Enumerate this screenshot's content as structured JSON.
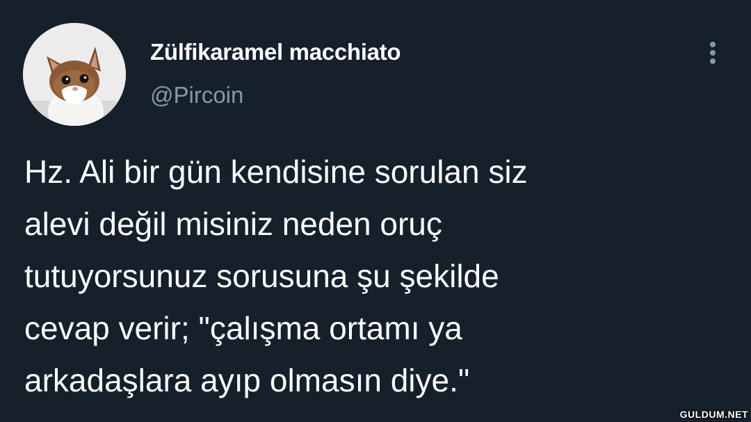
{
  "author": {
    "display_name": "Zülfikaramel macchiato",
    "handle": "@Pircoin",
    "avatar_icon": "cat-avatar"
  },
  "menu": {
    "icon": "more-vertical-icon"
  },
  "tweet": {
    "lines": [
      "Hz. Ali bir gün kendisine sorulan siz",
      "alevi değil misiniz neden oruç",
      "tutuyorsunuz sorusuna şu şekilde",
      "cevap verir; \"çalışma ortamı ya",
      "arkadaşlara ayıp olmasın diye.\""
    ]
  },
  "watermark": "GULDUM.NET",
  "colors": {
    "background": "#15202b",
    "primary_text": "#ffffff",
    "secondary_text": "#8899a6"
  }
}
